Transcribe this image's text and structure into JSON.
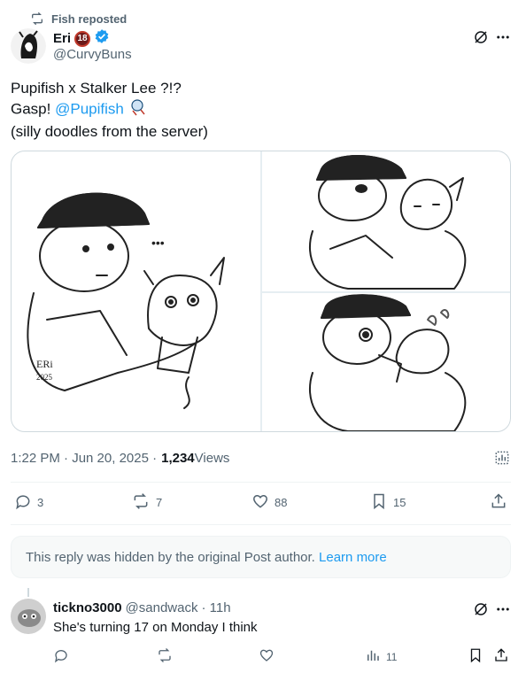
{
  "repost": {
    "label": "Fish reposted",
    "icon": "repost-icon"
  },
  "post": {
    "author_name": "Eri",
    "author_badge": "18",
    "author_handle": "@CurvyBuns",
    "text_line1": "Pupifish x Stalker Lee ?!?",
    "text_line2_prefix": "Gasp! ",
    "text_mention": "@Pupifish",
    "text_line3": "(silly doodles from the server)",
    "media_signature_1": "ERi",
    "media_signature_2": "2025",
    "timestamp": "1:22 PM · Jun 20, 2025 · ",
    "views_count": "1,234",
    "views_label": " Views",
    "stats": {
      "replies": "3",
      "reposts": "7",
      "likes": "88",
      "bookmarks": "15"
    }
  },
  "hidden_reply": {
    "text": "This reply was hidden by the original Post author.",
    "link": "Learn more"
  },
  "reply": {
    "author_name": "tickno3000",
    "author_handle": "@sandwack",
    "age": "· 11h",
    "text": "She's turning 17 on Monday I think",
    "views": "11"
  },
  "colors": {
    "accent": "#1d9bf0",
    "muted": "#536471",
    "text": "#0f1419",
    "badge": "#6b1a1a"
  }
}
